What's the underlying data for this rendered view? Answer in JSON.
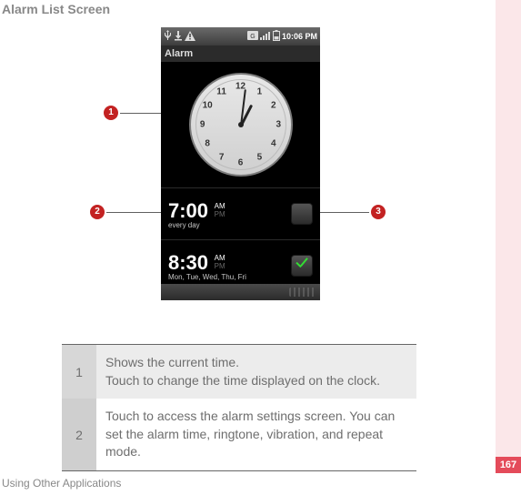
{
  "heading": "Alarm List Screen",
  "footer": "Using Other Applications",
  "page_number": "167",
  "status_bar": {
    "time": "10:06 PM"
  },
  "app_title": "Alarm",
  "clock": {
    "labels": {
      "n1": "1",
      "n2": "2",
      "n3": "3",
      "n4": "4",
      "n5": "5",
      "n6": "6",
      "n7": "7",
      "n8": "8",
      "n9": "9",
      "n10": "10",
      "n11": "11",
      "n12": "12"
    }
  },
  "alarms": [
    {
      "time": "7:00",
      "am": "AM",
      "pm": "PM",
      "sub": "every day",
      "checked": false
    },
    {
      "time": "8:30",
      "am": "AM",
      "pm": "PM",
      "sub": "Mon, Tue, Wed, Thu, Fri",
      "checked": true
    }
  ],
  "callouts": {
    "m1": "1",
    "m2": "2",
    "m3": "3"
  },
  "table": [
    {
      "n": "1",
      "text_a": "Shows the current time.",
      "text_b": "Touch to change the time displayed on the clock."
    },
    {
      "n": "2",
      "text_a": "Touch to access the alarm settings screen. You can set the alarm time, ringtone, vibration, and repeat mode."
    }
  ]
}
